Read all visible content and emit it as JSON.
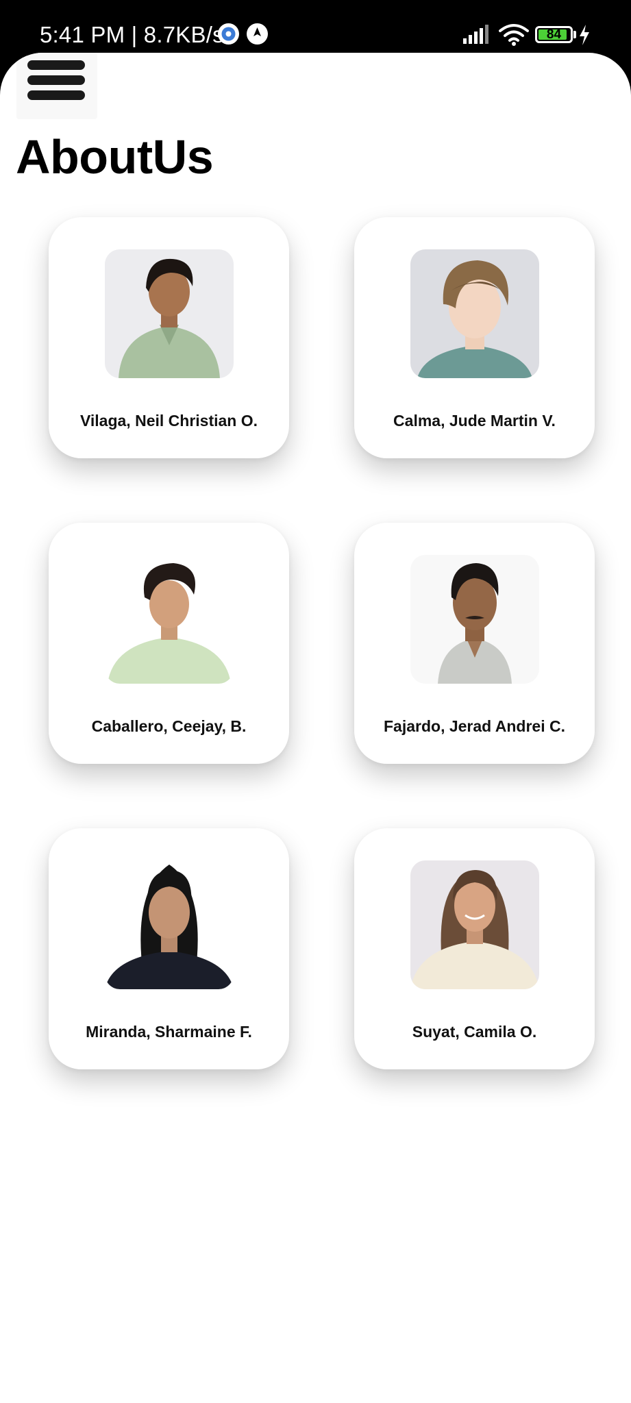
{
  "status_bar": {
    "time_speed": "5:41 PM | 8.7KB/s",
    "battery_level": "84",
    "icons": [
      "gear-icon",
      "location-pin-icon",
      "signal-icon",
      "wifi-icon",
      "battery-icon",
      "charging-bolt-icon"
    ]
  },
  "header": {
    "menu_icon": "hamburger-menu-icon",
    "title": "AboutUs"
  },
  "members": [
    {
      "name": "Vilaga, Neil Christian O."
    },
    {
      "name": "Calma, Jude Martin V."
    },
    {
      "name": "Caballero, Ceejay, B."
    },
    {
      "name": "Fajardo, Jerad Andrei C."
    },
    {
      "name": "Miranda, Sharmaine F."
    },
    {
      "name": "Suyat, Camila O."
    }
  ],
  "colors": {
    "background": "#ffffff",
    "status_bar": "#000000",
    "card": "#ffffff",
    "text": "#111111",
    "battery_fill": "#4cd137"
  }
}
